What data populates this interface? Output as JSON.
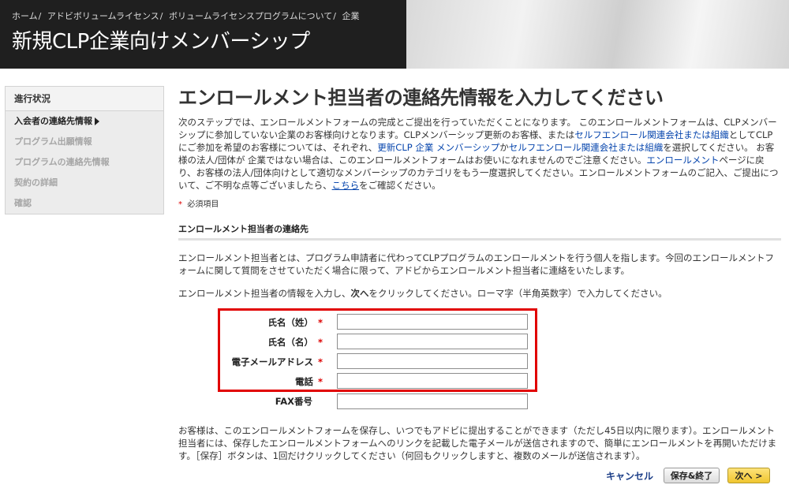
{
  "breadcrumb": [
    "ホーム",
    "アドビボリュームライセンス",
    "ボリュームライセンスプログラムについて",
    "企業"
  ],
  "breadcrumb_sep": "/",
  "header_title": "新規CLP企業向けメンバーシップ",
  "sidebar": {
    "heading": "進行状況",
    "items": [
      {
        "label": "入会者の連絡先情報",
        "active": true
      },
      {
        "label": "プログラム出願情報",
        "active": false
      },
      {
        "label": "プログラムの連絡先情報",
        "active": false
      },
      {
        "label": "契約の詳細",
        "active": false
      },
      {
        "label": "確認",
        "active": false
      }
    ]
  },
  "main_title": "エンロールメント担当者の連絡先情報を入力してください",
  "intro": {
    "t1": "次のステップでは、エンロールメントフォームの完成とご提出を行っていただくことになります。 このエンロールメントフォームは、CLPメンバーシップに参加していない企業のお客様向けとなります。CLPメンバーシップ更新のお客様、または",
    "l1": "セルフエンロール関連会社または組織",
    "t2": "としてCLPにご参加を希望のお客様については、それぞれ、",
    "l2": "更新CLP 企業 メンバーシップ",
    "t3": "か",
    "l3": "セルフエンロール関連会社または組織",
    "t4": "を選択してください。 お客様の法人/団体が 企業ではない場合は、このエンロールメントフォームはお使いになれませんのでご注意ください。",
    "l4": "エンロールメント",
    "t5": "ページに戻り、お客様の法人/団体向けとして適切なメンバーシップのカテゴリをもう一度選択してください。エンロールメントフォームのご記入、ご提出について、ご不明な点等ございましたら、",
    "l5": "こちら",
    "t6": "をご確認ください。"
  },
  "required_marker": "*",
  "required_note": "必須項目",
  "section_title": "エンロールメント担当者の連絡先",
  "para1": "エンロールメント担当者とは、プログラム申請者に代わってCLPプログラムのエンロールメントを行う個人を指します。今回のエンロールメントフォームに関して質問をさせていただく場合に限って、アドビからエンロールメント担当者に連絡をいたします。",
  "para2": {
    "a": "エンロールメント担当者の情報を入力し、",
    "bold": "次へ",
    "b": "をクリックしてください。ローマ字（半角英数字）で入力してください。"
  },
  "form": {
    "last_name_label": "氏名（姓）",
    "first_name_label": "氏名（名）",
    "email_label": "電子メールアドレス",
    "phone_label": "電話",
    "fax_label": "FAX番号",
    "last_name_value": "",
    "first_name_value": "",
    "email_value": "",
    "phone_value": "",
    "fax_value": ""
  },
  "footer_text": "お客様は、このエンロールメントフォームを保存し、いつでもアドビに提出することができます（ただし45日以内に限ります）。エンロールメント担当者には、保存したエンロールメントフォームへのリンクを記載した電子メールが送信されますので、簡単にエンロールメントを再開いただけます。［保存］ボタンは、1回だけクリックしてください（何回もクリックしますと、複数のメールが送信されます）。",
  "buttons": {
    "cancel": "キャンセル",
    "save": "保存&終了",
    "next": "次へ >"
  },
  "colors": {
    "highlight_border": "#e10000",
    "link": "#0645ad",
    "next_button": "#f0c62f",
    "header_dark": "#1f1f1f"
  }
}
